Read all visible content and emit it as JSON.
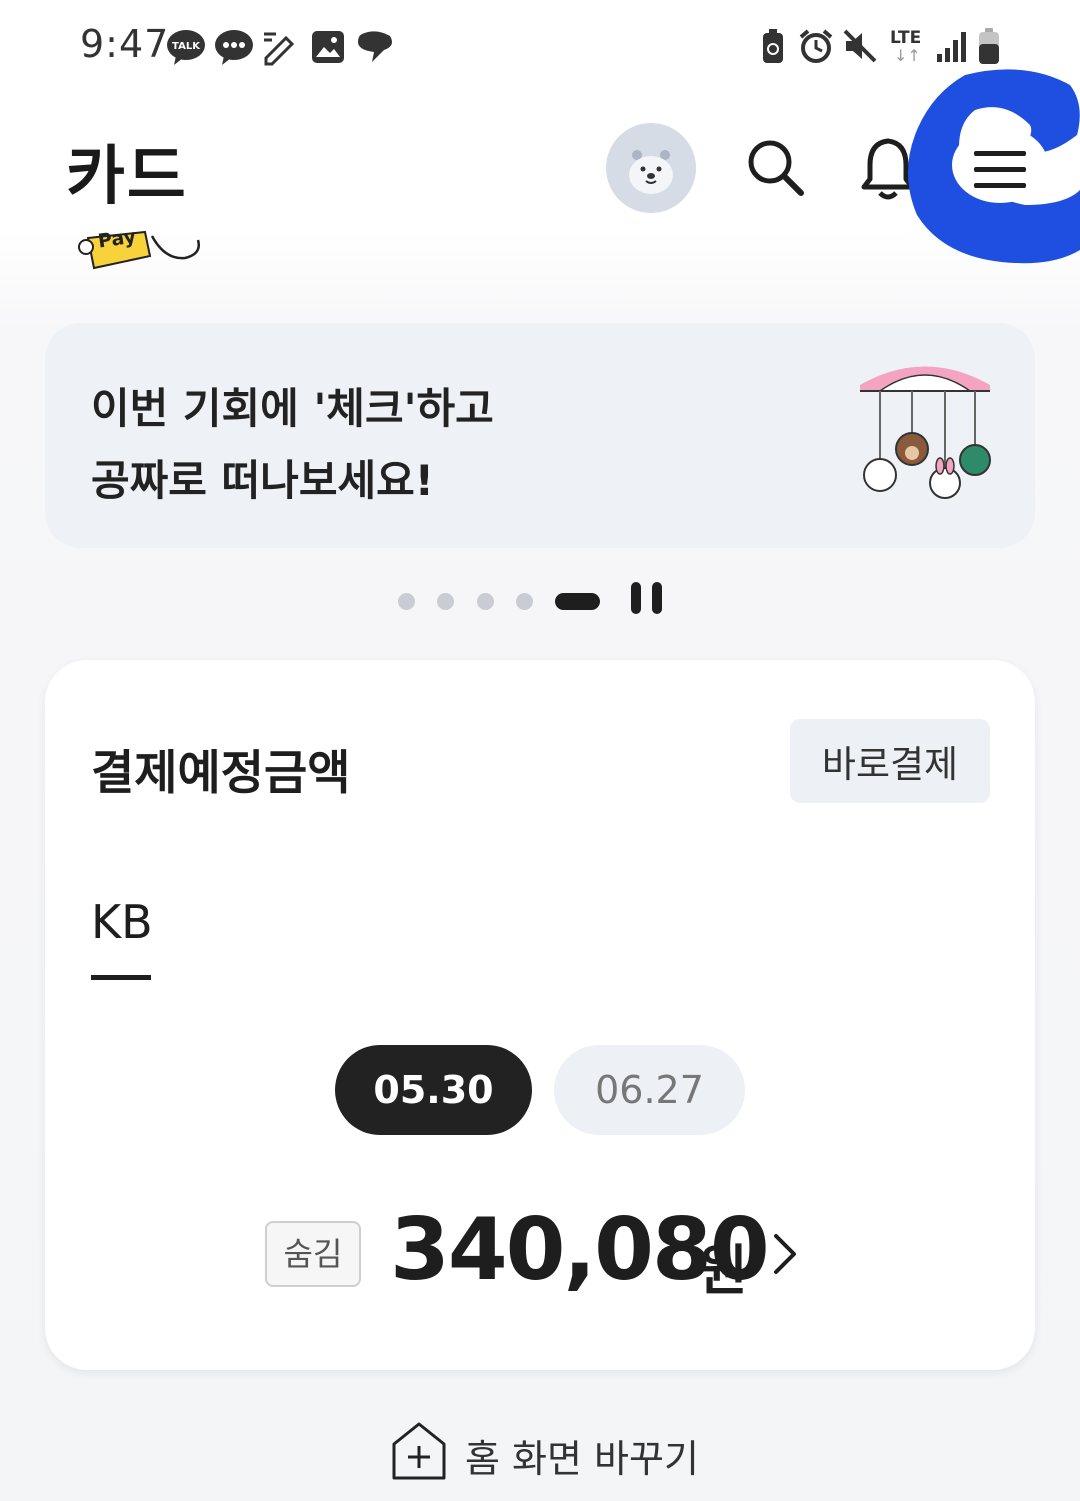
{
  "status_bar": {
    "time": "9:47",
    "left_icons": [
      "kakaotalk-icon",
      "chat-bubble-icon",
      "edit-icon",
      "gallery-icon",
      "app-icon"
    ],
    "right_icons": [
      "battery-saver-icon",
      "alarm-icon",
      "mute-icon",
      "lte-icon",
      "signal-icon",
      "battery-icon"
    ],
    "lte_label": "LTE"
  },
  "header": {
    "title": "카드",
    "icons": [
      "avatar",
      "search-icon",
      "bell-icon",
      "menu-icon"
    ]
  },
  "pay_peek": {
    "label": "Pay"
  },
  "banner": {
    "line1": "이번 기회에 '체크'하고",
    "line2": "공짜로 떠나보세요!"
  },
  "pager": {
    "total": 5,
    "active_index": 4
  },
  "payment_card": {
    "title": "결제예정금액",
    "pay_now_label": "바로결제",
    "tab_label": "KB",
    "dates": [
      {
        "label": "05.30",
        "active": true
      },
      {
        "label": "06.27",
        "active": false
      }
    ],
    "hide_label": "숨김",
    "amount": "340,080",
    "currency": "원"
  },
  "footer": {
    "change_home_label": "홈 화면 바꾸기"
  },
  "colors": {
    "dark": "#1e1e1e",
    "banner_bg": "#eef1f5",
    "pill_inactive": "#edf0f4",
    "scribble_blue": "#1f4fe0"
  }
}
